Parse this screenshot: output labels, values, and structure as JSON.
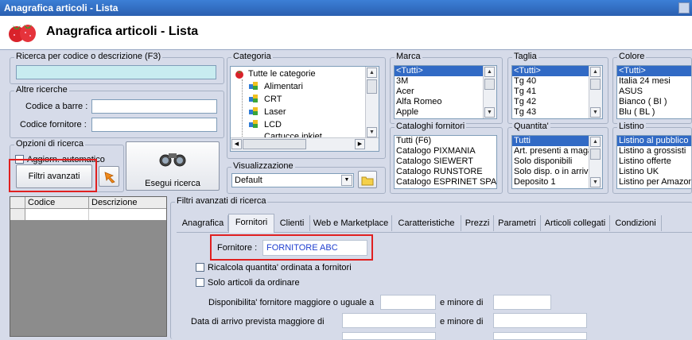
{
  "window": {
    "title": "Anagrafica articoli  - Lista"
  },
  "header": {
    "title": "Anagrafica articoli  - Lista"
  },
  "search": {
    "label": "Ricerca per codice o descrizione (F3)",
    "value": ""
  },
  "altre": {
    "label": "Altre ricerche",
    "barcode_label": "Codice a barre :",
    "fornitore_label": "Codice fornitore :"
  },
  "opzioni": {
    "label": "Opzioni di ricerca",
    "auto_label": "Aggiorn. automatico",
    "filtri_label": "Filtri avanzati",
    "esegui_label": "Esegui ricerca"
  },
  "categoria": {
    "label": "Categoria",
    "items": [
      "Tutte le categorie",
      "Alimentari",
      "CRT",
      "Laser",
      "LCD",
      "Cartucce inkjet"
    ]
  },
  "visualizzazione": {
    "label": "Visualizzazione",
    "value": "Default"
  },
  "marca": {
    "label": "Marca",
    "items": [
      "<Tutti>",
      "3M",
      "Acer",
      "Alfa Romeo",
      "Apple"
    ]
  },
  "taglia": {
    "label": "Taglia",
    "items": [
      "<Tutti>",
      "Tg 40",
      "Tg 41",
      "Tg 42",
      "Tg 43"
    ]
  },
  "colore": {
    "label": "Colore",
    "items": [
      "<Tutti>",
      "Italia 24 mesi",
      "ASUS",
      "Bianco ( BI )",
      "Blu ( BL )"
    ]
  },
  "cataloghi": {
    "label": "Cataloghi fornitori",
    "items": [
      "Tutti (F6)",
      "Catalogo PIXMANIA",
      "Catalogo SIEWERT",
      "Catalogo RUNSTORE",
      "Catalogo ESPRINET SPA"
    ]
  },
  "quantita": {
    "label": "Quantita'",
    "items": [
      "Tutti",
      "Art. presenti a magazzino",
      "Solo disponibili",
      "Solo disp. o in arrivo",
      "Deposito 1"
    ]
  },
  "listino": {
    "label": "Listino",
    "items": [
      "Listino al pubblico",
      "Listino a grossisti",
      "Listino offerte",
      "Listino UK",
      "Listino per Amazon"
    ]
  },
  "grid": {
    "col_codice": "Codice",
    "col_descrizione": "Descrizione"
  },
  "filtri": {
    "label": "Filtri avanzati di ricerca",
    "tabs": [
      "Anagrafica",
      "Fornitori",
      "Clienti",
      "Web e Marketplace",
      "Caratteristiche",
      "Prezzi",
      "Parametri",
      "Articoli collegati",
      "Condizioni"
    ],
    "fornitore_label": "Fornitore :",
    "fornitore_value": "FORNITORE ABC",
    "ricalcola_label": "Ricalcola quantita' ordinata a fornitori",
    "solo_label": "Solo articoli da ordinare",
    "disp_label": "Disponibilita' fornitore maggiore o uguale a",
    "minore_label": "e minore di",
    "arrivo_label": "Data di arrivo prevista maggiore di",
    "minore2_label": "e minore di"
  },
  "colors": {
    "selection": "#316ac5",
    "highlight": "#e02020",
    "search_bg": "#c8ecf0"
  }
}
